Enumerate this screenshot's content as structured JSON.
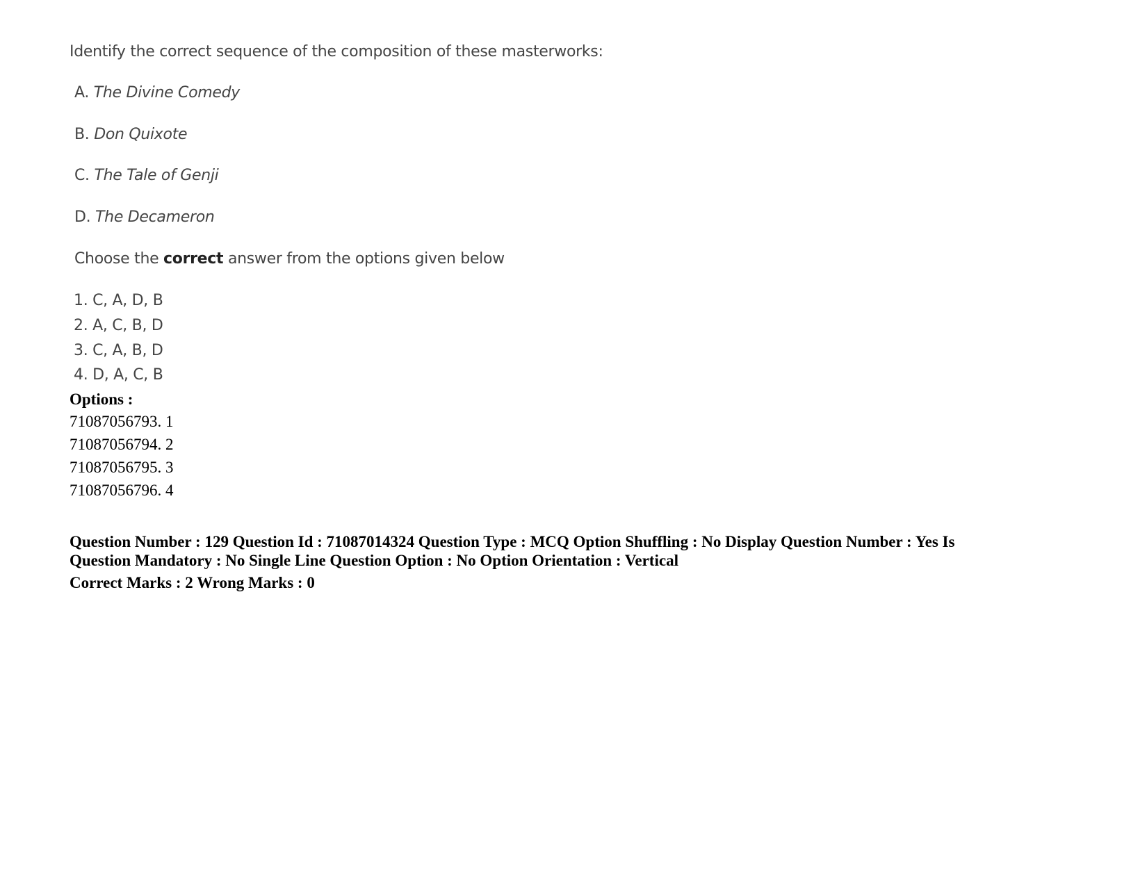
{
  "question": {
    "stem": "Identify the correct sequence of the composition of these masterworks:",
    "items": [
      {
        "label": "A.",
        "title": "The Divine Comedy"
      },
      {
        "label": "B.",
        "title": "Don Quixote"
      },
      {
        "label": "C.",
        "title": "The Tale of Genji"
      },
      {
        "label": "D.",
        "title": "The Decameron"
      }
    ],
    "instruction_pre": "Choose the ",
    "instruction_bold": "correct",
    "instruction_post": " answer from the options given below",
    "answers": [
      "1. C, A, D, B",
      "2. A, C, B, D",
      "3. C, A, B, D",
      "4. D, A, C, B"
    ]
  },
  "options": {
    "heading": "Options :",
    "list": [
      "71087056793. 1",
      "71087056794. 2",
      "71087056795. 3",
      "71087056796. 4"
    ]
  },
  "meta": {
    "line1": "Question Number : 129 Question Id : 71087014324 Question Type : MCQ Option Shuffling : No Display Question Number : Yes Is Question Mandatory : No Single Line Question Option : No Option Orientation : Vertical",
    "line2": "Correct Marks : 2 Wrong Marks : 0"
  }
}
